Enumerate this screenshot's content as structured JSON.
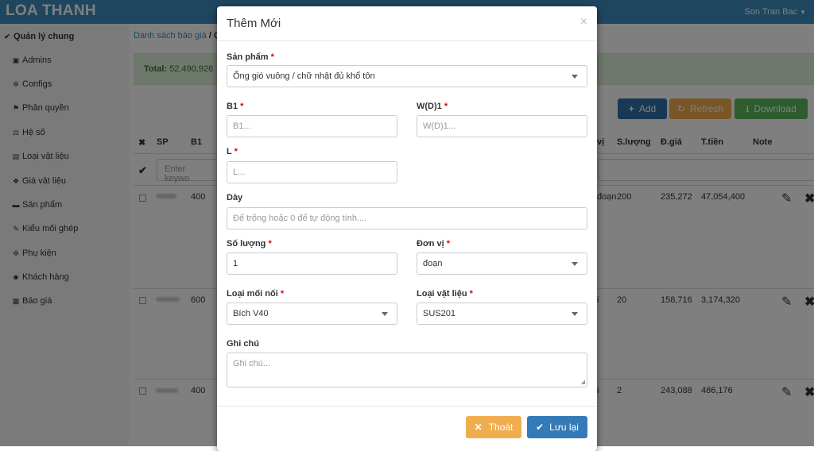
{
  "app": {
    "brand": "LOA THANH",
    "user": "Son Tran Bac"
  },
  "sidebar": {
    "items": [
      {
        "label": "Quản lý chung",
        "icon": "check-icon",
        "glyph": "✔"
      },
      {
        "label": "Admins",
        "icon": "lock-icon",
        "glyph": "🔒"
      },
      {
        "label": "Configs",
        "icon": "gear-icon",
        "glyph": "✲"
      },
      {
        "label": "Phân quyền",
        "icon": "flag-icon",
        "glyph": "⚑"
      },
      {
        "label": "Hệ số",
        "icon": "scale-icon",
        "glyph": "⚖"
      },
      {
        "label": "Loại vật liệu",
        "icon": "book-icon",
        "glyph": "▤"
      },
      {
        "label": "Giá vật liệu",
        "icon": "cubes-icon",
        "glyph": "❖"
      },
      {
        "label": "Sản phẩm",
        "icon": "car-icon",
        "glyph": "▬"
      },
      {
        "label": "Kiểu mối ghép",
        "icon": "wrench-icon",
        "glyph": "✎"
      },
      {
        "label": "Phụ kiện",
        "icon": "cogs-icon",
        "glyph": "✲"
      },
      {
        "label": "Khách hàng",
        "icon": "users-icon",
        "glyph": "☻"
      },
      {
        "label": "Báo giá",
        "icon": "table-icon",
        "glyph": "▦"
      }
    ]
  },
  "breadcrumb": {
    "link": "Danh sách báo giá",
    "separator": " / ",
    "current": "Q"
  },
  "alert": {
    "label": "Total:",
    "value": "52,490,926"
  },
  "toolbar": {
    "add": "Add",
    "refresh": "Refresh",
    "download": "Download"
  },
  "table": {
    "headers": {
      "remove": "✖",
      "sp": "SP",
      "b1": "B1",
      "unit": "vị",
      "qty": "S.lượng",
      "price": "Đ.giá",
      "total": "T.tiền",
      "note": "Note"
    },
    "filter_placeholder": "Enter keywo",
    "rows": [
      {
        "b1": "400",
        "unit": "đoạn",
        "qty": "200",
        "price": "235,272",
        "total": "47,054,400"
      },
      {
        "b1": "600",
        "unit": "i",
        "qty": "20",
        "price": "158,716",
        "total": "3,174,320"
      },
      {
        "b1": "400",
        "unit": "i",
        "qty": "2",
        "price": "243,088",
        "total": "486,176"
      }
    ]
  },
  "modal": {
    "title": "Thêm Mới",
    "close": "×",
    "product": {
      "label": "Sản phẩm",
      "value": "Ống gió vuông / chữ nhật đủ khổ tôn"
    },
    "b1": {
      "label": "B1",
      "placeholder": "B1..."
    },
    "wd1": {
      "label": "W(D)1",
      "placeholder": "W(D)1..."
    },
    "l": {
      "label": "L",
      "placeholder": "L..."
    },
    "thickness": {
      "label": "Dày",
      "placeholder": "Để trống hoặc 0 để tự động tính...."
    },
    "quantity": {
      "label": "Số lượng",
      "value": "1"
    },
    "unit": {
      "label": "Đơn vị",
      "value": "đoạn"
    },
    "joint": {
      "label": "Loại mối nối",
      "value": "Bích V40"
    },
    "material": {
      "label": "Loại vật liệu",
      "value": "SUS201"
    },
    "note": {
      "label": "Ghi chú",
      "placeholder": "Ghi chú..."
    },
    "required_mark": "*",
    "buttons": {
      "exit": "Thoát",
      "save": "Lưu lại"
    }
  },
  "colors": {
    "primary": "#3c8dbc",
    "add": "#3071a9",
    "refresh": "#f0ad4e",
    "download": "#5cb85c",
    "exit": "#f0ad4e",
    "save": "#337ab7",
    "required": "#dd0000"
  }
}
